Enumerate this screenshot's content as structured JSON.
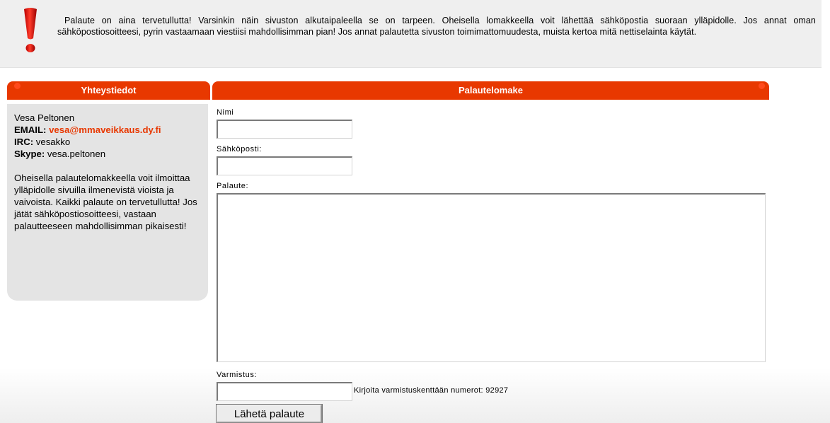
{
  "notice": {
    "icon": "exclamation-icon",
    "text": "Palaute on aina tervetullutta! Varsinkin näin sivuston alkutaipaleella se on tarpeen. Oheisella lomakkeella voit lähettää sähköpostia suoraan ylläpidolle. Jos annat oman sähköpostiosoitteesi, pyrin vastaamaan viestiisi mahdollisimman pian! Jos annat palautetta sivuston toimimattomuudesta, muista kertoa mitä nettiselainta käytät."
  },
  "contact": {
    "header": "Yhteystiedot",
    "name": "Vesa Peltonen",
    "email_label": "EMAIL:",
    "email": "vesa@mmaveikkaus.dy.fi",
    "irc_label": "IRC:",
    "irc": "vesakko",
    "skype_label": "Skype:",
    "skype": "vesa.peltonen",
    "description": "Oheisella palautelomakkeella voit ilmoittaa ylläpidolle sivuilla ilmenevistä vioista ja vaivoista. Kaikki palaute on tervetullutta! Jos jätät sähköpostiosoitteesi, vastaan palautteeseen mahdollisimman pikaisesti!"
  },
  "form": {
    "header": "Palautelomake",
    "name_label": "Nimi",
    "name_value": "",
    "email_label": "Sähköposti:",
    "email_value": "",
    "feedback_label": "Palaute:",
    "feedback_value": "",
    "verify_label": "Varmistus:",
    "verify_value": "",
    "verify_hint": "Kirjoita varmistuskenttään numerot: 92927",
    "submit_label": "Lähetä palaute"
  },
  "colors": {
    "accent": "#e83800",
    "notice_bg": "#efefef",
    "panel_bg": "#e4e4e4"
  }
}
